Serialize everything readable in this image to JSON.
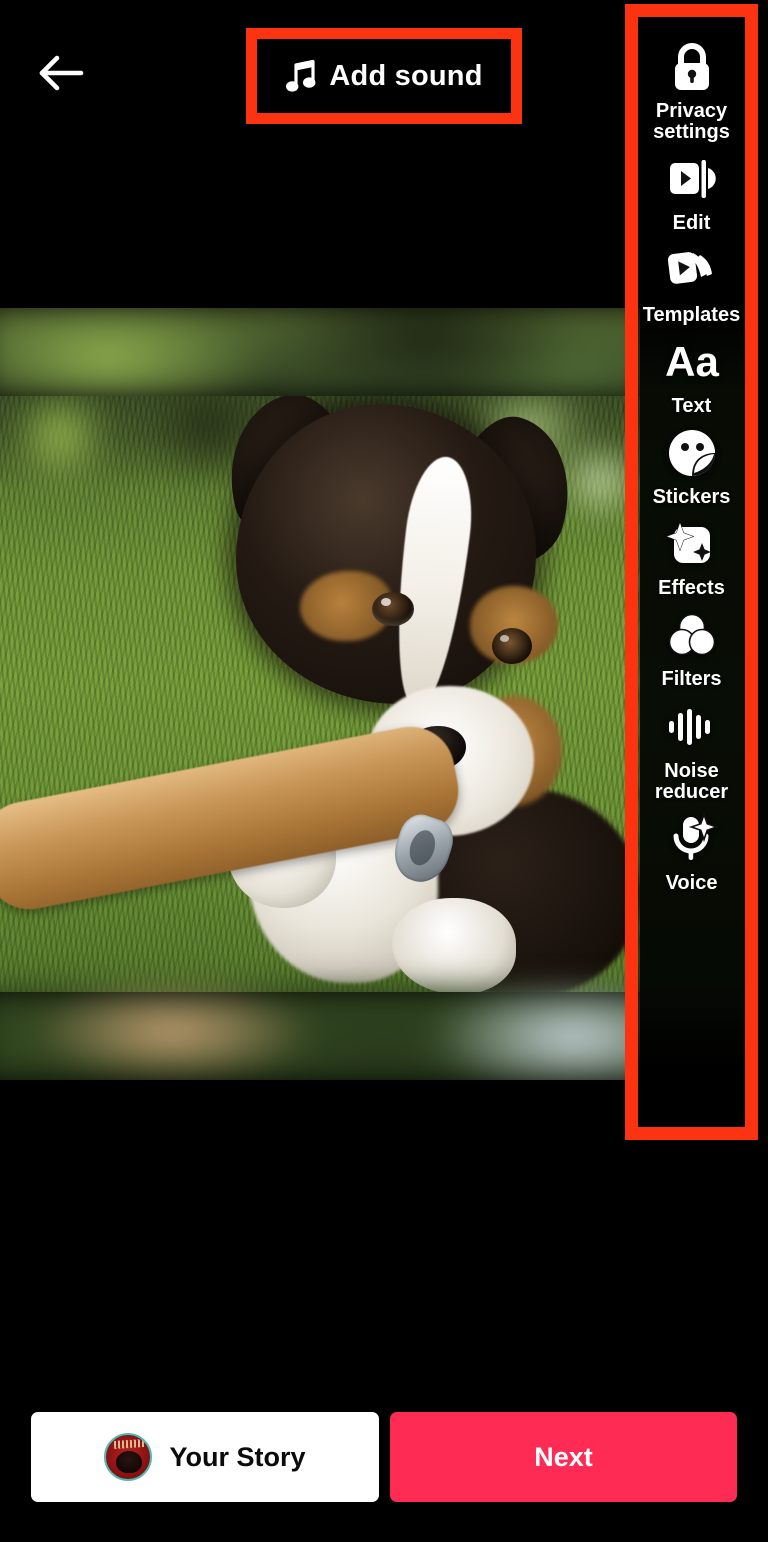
{
  "screen": {
    "title": "Video post editor",
    "background_color": "#000000"
  },
  "colors": {
    "highlight_red": "#FB3311",
    "next_button": "#FE2C55",
    "story_button": "#FFFFFF",
    "text_light": "#FFFFFF",
    "text_dark": "#0B0B0B",
    "avatar_ring": "#52B8B8"
  },
  "top_bar": {
    "back_button": {
      "name": "back",
      "icon": "arrow-left-icon"
    },
    "add_sound": {
      "label": "Add sound",
      "icon": "music-note-icon",
      "highlighted": true,
      "highlight_color": "#FB3311"
    }
  },
  "tools_panel": {
    "highlighted": true,
    "highlight_color": "#FB3311",
    "items": [
      {
        "label": "Privacy\nsettings",
        "icon": "lock-icon"
      },
      {
        "label": "Edit",
        "icon": "video-edit-icon"
      },
      {
        "label": "Templates",
        "icon": "templates-cards-icon"
      },
      {
        "label": "Text",
        "icon": "text-aa-icon"
      },
      {
        "label": "Stickers",
        "icon": "sticker-smiley-icon"
      },
      {
        "label": "Effects",
        "icon": "sparkle-effects-icon"
      },
      {
        "label": "Filters",
        "icon": "filters-circles-icon"
      },
      {
        "label": "Noise\nreducer",
        "icon": "audio-waveform-icon"
      },
      {
        "label": "Voice",
        "icon": "microphone-sparkle-icon"
      }
    ]
  },
  "preview": {
    "description": "Video preview of a tri-color puppy chewing a stick on green grass",
    "letterbox": true
  },
  "bottom_bar": {
    "your_story": {
      "label": "Your Story",
      "avatar": "profile-avatar"
    },
    "next": {
      "label": "Next"
    }
  }
}
